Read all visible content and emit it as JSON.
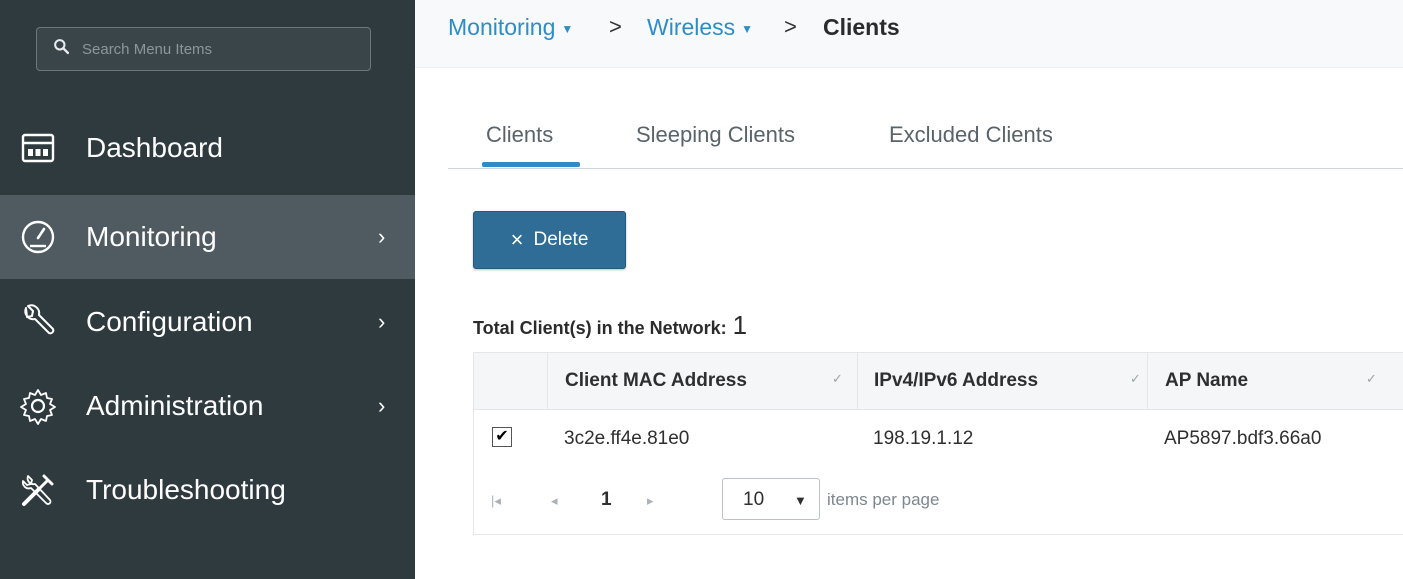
{
  "search": {
    "placeholder": "Search Menu Items",
    "icon": "search-icon"
  },
  "sidebar": {
    "items": [
      {
        "label": "Dashboard",
        "icon": "dashboard-icon",
        "has_chevron": false,
        "active": false
      },
      {
        "label": "Monitoring",
        "icon": "gauge-icon",
        "has_chevron": true,
        "active": true
      },
      {
        "label": "Configuration",
        "icon": "wrench-icon",
        "has_chevron": true,
        "active": false
      },
      {
        "label": "Administration",
        "icon": "gear-icon",
        "has_chevron": true,
        "active": false
      },
      {
        "label": "Troubleshooting",
        "icon": "tools-icon",
        "has_chevron": false,
        "active": false
      }
    ],
    "chevron": "›"
  },
  "breadcrumb": {
    "items": [
      "Monitoring",
      "Wireless"
    ],
    "separator": ">",
    "current": "Clients"
  },
  "tabs": {
    "items": [
      "Clients",
      "Sleeping Clients",
      "Excluded Clients"
    ],
    "active_index": 0
  },
  "actions": {
    "delete_icon": "×",
    "delete_label": "Delete"
  },
  "summary": {
    "label": "Total Client(s) in the Network:",
    "count": "1"
  },
  "table": {
    "columns": [
      "Client MAC Address",
      "IPv4/IPv6 Address",
      "AP Name"
    ],
    "rows": [
      {
        "checked": true,
        "cells": [
          "3c2e.ff4e.81e0",
          "198.19.1.12",
          "AP5897.bdf3.66a0"
        ]
      }
    ]
  },
  "pagination": {
    "current_page": "1",
    "per_page": "10",
    "per_page_label": "items per page"
  },
  "colors": {
    "sidebar_bg": "#2f3a3e",
    "sidebar_active": "#4f5b60",
    "accent": "#2e8bc9",
    "button": "#2f6d96"
  }
}
